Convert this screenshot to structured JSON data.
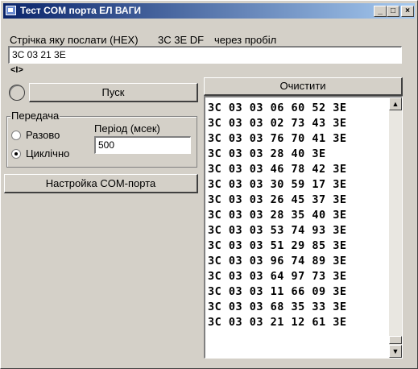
{
  "window": {
    "title": "Тест  COM порта ЕЛ ВАГИ"
  },
  "titlebar_buttons": {
    "minimize": "_",
    "maximize": "□",
    "close": "×"
  },
  "send_line": {
    "label": "Стрічка яку послати (HEX)",
    "example": "3C 3E DF",
    "hint": "через пробіл",
    "value": "3C 03 21 3E",
    "marker": "<I>"
  },
  "start_button": {
    "label": "Пуск"
  },
  "transmission": {
    "title": "Передача",
    "once_label": "Разово",
    "cyclic_label": "Циклічно",
    "selected": "Циклічно",
    "period_label": "Період (мсек)",
    "period_value": "500"
  },
  "com_settings_button": {
    "label": "Настройка COM-порта"
  },
  "clear_button": {
    "label": "Очистити"
  },
  "log": {
    "rows": [
      "3C 03 03 06 60 52 3E",
      "3C 03 03 02 73 43 3E",
      "3C 03 03 76 70 41 3E",
      "3C 03 03 28 40 3E",
      "3C 03 03 46 78 42 3E",
      "3C 03 03 30 59 17 3E",
      "3C 03 03 26 45 37 3E",
      "3C 03 03 28 35 40 3E",
      "3C 03 03 53 74 93 3E",
      "3C 03 03 51 29 85 3E",
      "3C 03 03 96 74 89 3E",
      "3C 03 03 64 97 73 3E",
      "3C 03 03 11 66 09 3E",
      "3C 03 03 68 35 33 3E",
      "3C 03 03 21 12 61 3E"
    ]
  }
}
